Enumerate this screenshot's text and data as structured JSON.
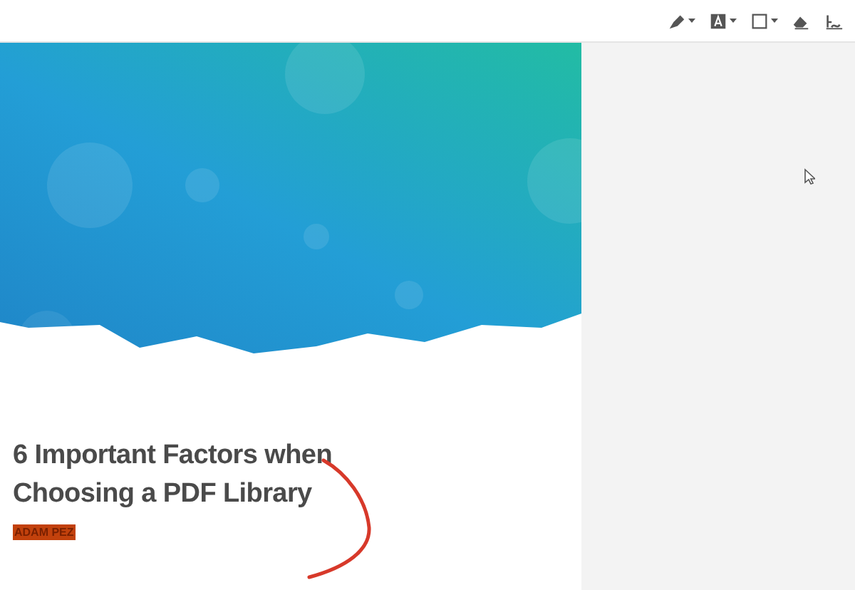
{
  "toolbar": {
    "tools": [
      {
        "kind": "pen",
        "dropdown": true
      },
      {
        "kind": "text",
        "dropdown": true
      },
      {
        "kind": "rectangle",
        "dropdown": true
      },
      {
        "kind": "eraser",
        "dropdown": false
      },
      {
        "kind": "signature",
        "dropdown": false
      }
    ]
  },
  "document": {
    "title_lines": [
      "6 Important Factors when",
      "Choosing a PDF Library"
    ],
    "author": "ADAM PEZ"
  }
}
